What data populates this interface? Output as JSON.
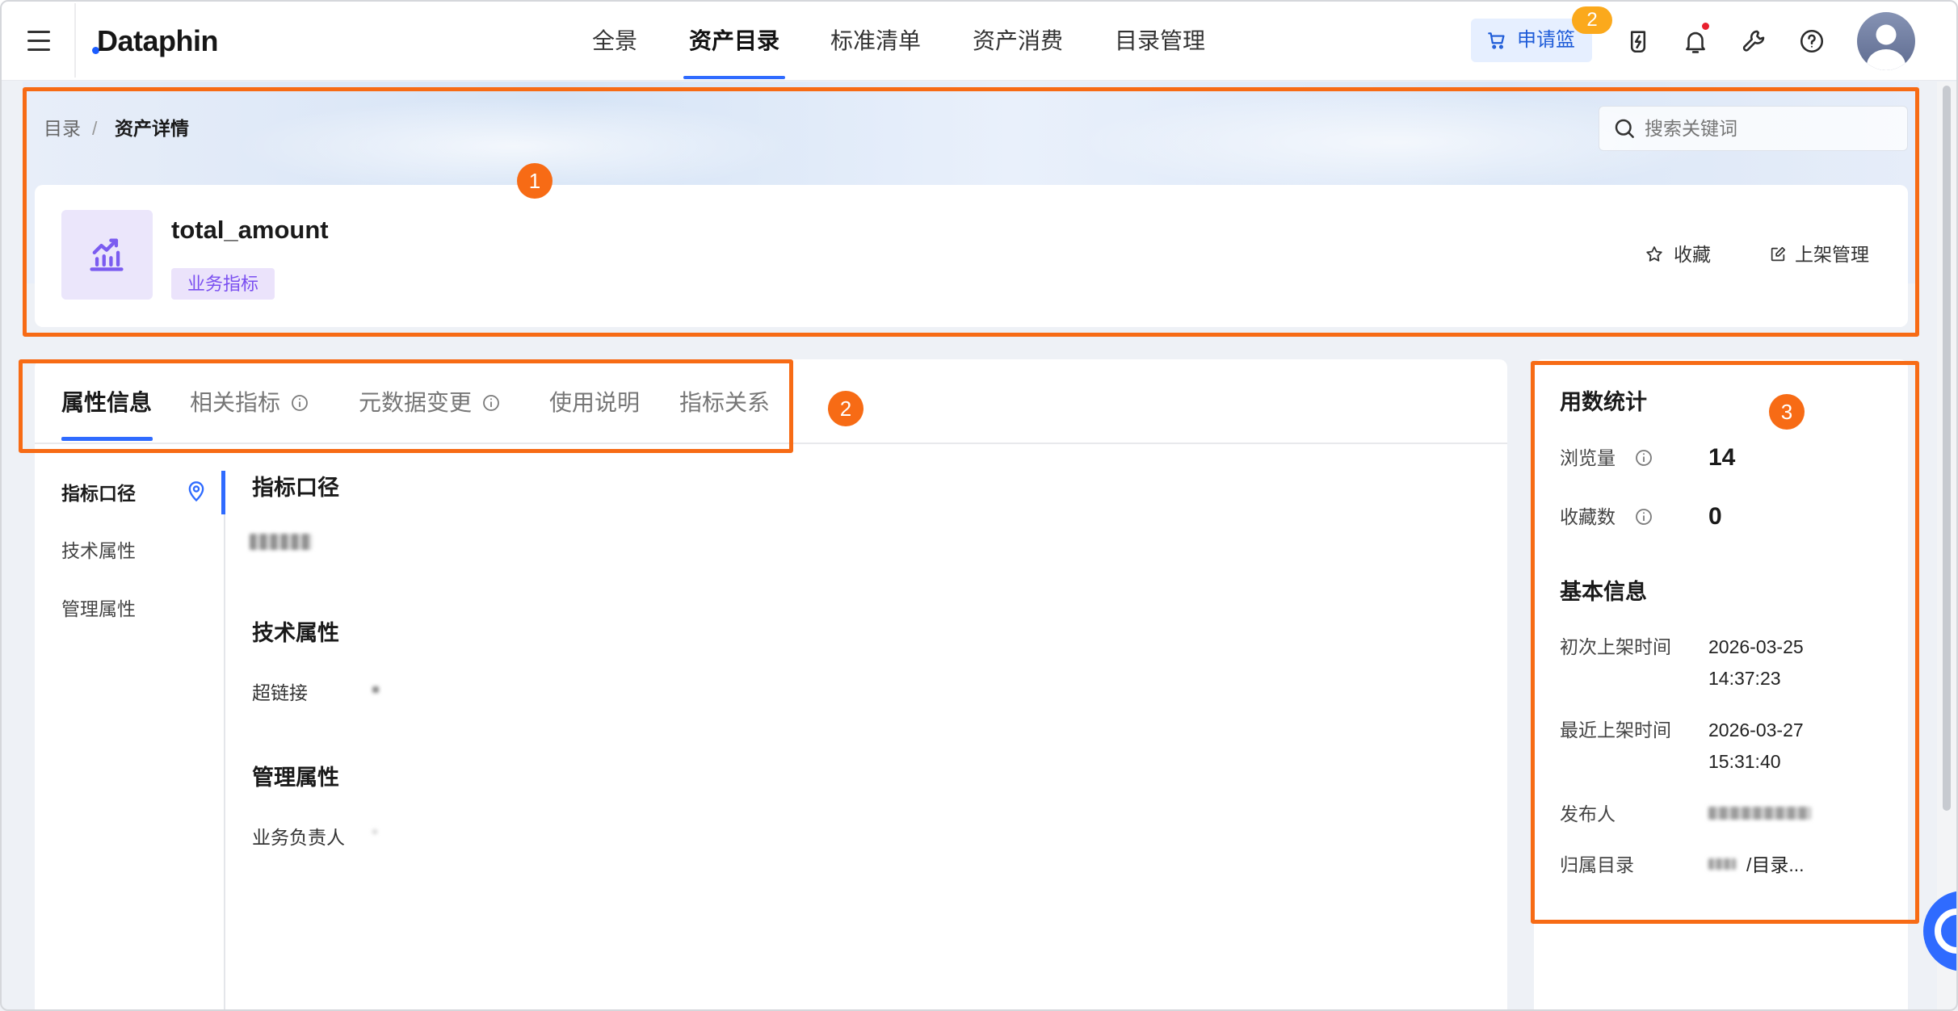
{
  "header": {
    "menu_icon": "hamburger-menu-icon",
    "logo": "Dataphin",
    "nav": [
      {
        "label": "全景",
        "active": false
      },
      {
        "label": "资产目录",
        "active": true
      },
      {
        "label": "标准清单",
        "active": false
      },
      {
        "label": "资产消费",
        "active": false
      },
      {
        "label": "目录管理",
        "active": false
      }
    ],
    "cart": {
      "label": "申请篮",
      "badge": "2",
      "icon": "cart-icon"
    },
    "icons": [
      "lightning-icon",
      "bell-icon",
      "wrench-icon",
      "help-icon",
      "user-avatar"
    ],
    "notification_dot": true
  },
  "breadcrumb": {
    "items": [
      "目录",
      "资产详情"
    ],
    "separator": "/"
  },
  "search": {
    "placeholder": "搜索关键词",
    "value": ""
  },
  "asset": {
    "name": "total_amount",
    "type_tag": "业务指标",
    "icon": "metric-chart-icon",
    "actions": {
      "favorite": "收藏",
      "listing_manage": "上架管理"
    }
  },
  "tabs": [
    {
      "label": "属性信息",
      "active": true,
      "info_icon": false
    },
    {
      "label": "相关指标",
      "active": false,
      "info_icon": true
    },
    {
      "label": "元数据变更",
      "active": false,
      "info_icon": true
    },
    {
      "label": "使用说明",
      "active": false,
      "info_icon": false
    },
    {
      "label": "指标关系",
      "active": false,
      "info_icon": false
    }
  ],
  "side_nav": [
    {
      "label": "指标口径",
      "active": true
    },
    {
      "label": "技术属性",
      "active": false
    },
    {
      "label": "管理属性",
      "active": false
    }
  ],
  "sections": {
    "definition": {
      "title": "指标口径"
    },
    "technical": {
      "title": "技术属性",
      "fields": [
        {
          "label": "超链接"
        }
      ]
    },
    "management": {
      "title": "管理属性",
      "fields": [
        {
          "label": "业务负责人"
        }
      ]
    }
  },
  "usage_stats": {
    "title": "用数统计",
    "items": [
      {
        "label": "浏览量",
        "value": "14"
      },
      {
        "label": "收藏数",
        "value": "0"
      }
    ]
  },
  "basic_info": {
    "title": "基本信息",
    "items": [
      {
        "label": "初次上架时间",
        "date": "2026-03-25",
        "time": "14:37:23"
      },
      {
        "label": "最近上架时间",
        "date": "2026-03-27",
        "time": "15:31:40"
      },
      {
        "label": "发布人"
      },
      {
        "label": "归属目录",
        "value_suffix": "/目录..."
      }
    ]
  },
  "annotation_markers": [
    "1",
    "2",
    "3"
  ],
  "colors": {
    "accent": "#2f6bff",
    "annotation": "#f76b15",
    "tag_text": "#7a4ff0",
    "tag_bg": "#ebe3fb",
    "badge": "#fba91c",
    "notification_dot": "#e8202e"
  }
}
